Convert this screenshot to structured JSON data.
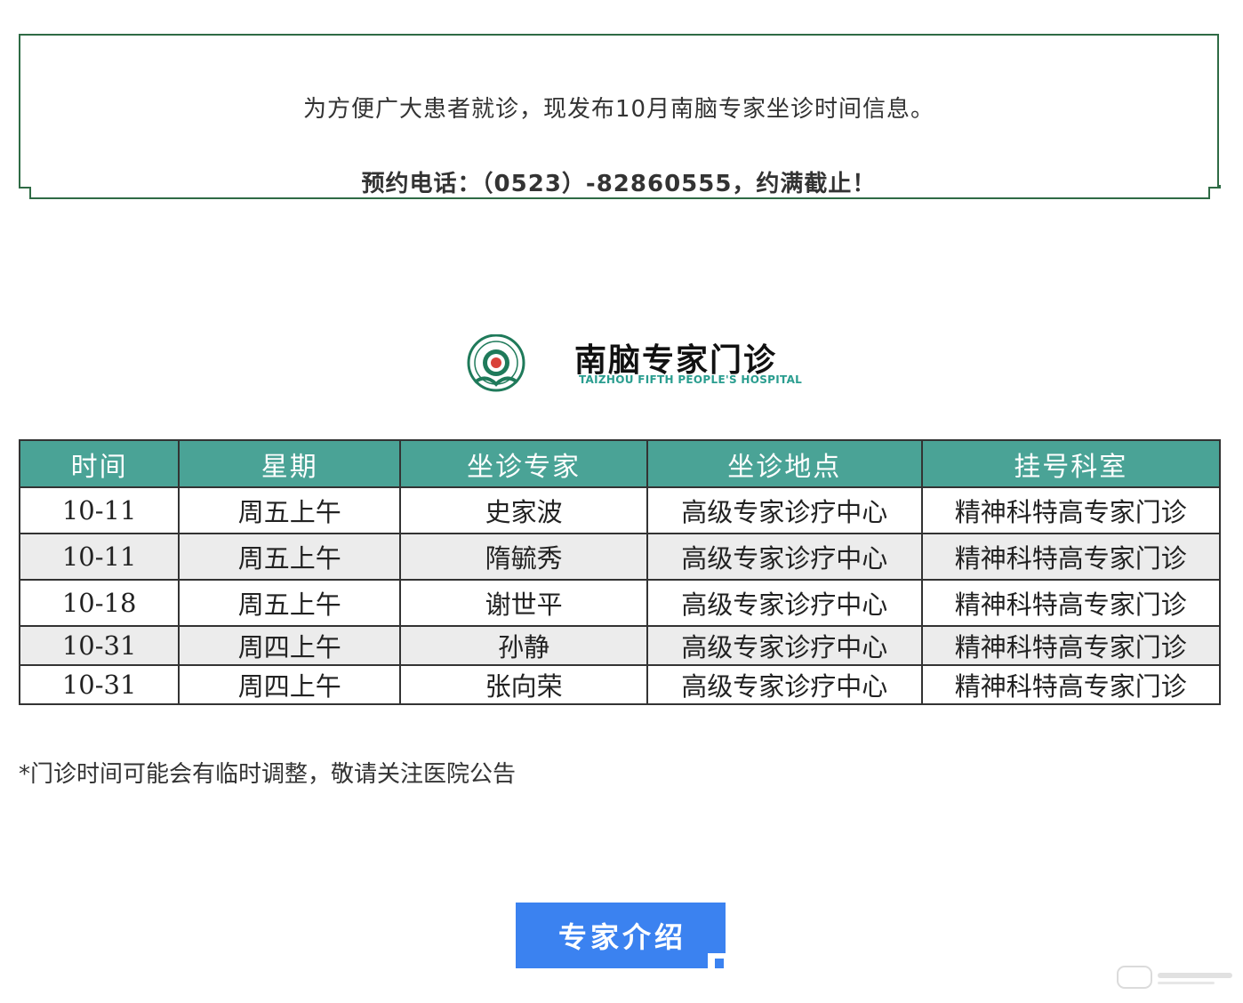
{
  "notice": {
    "line1": "为方便广大患者就诊，现发布10月南脑专家坐诊时间信息。",
    "line2": "预约电话：（0523）-82860555，约满截止！"
  },
  "header": {
    "title": "南脑专家门诊",
    "subtitle": "TAIZHOU FIFTH PEOPLE'S HOSPITAL",
    "logo_icon": "hospital-emblem-icon"
  },
  "table": {
    "columns": [
      "时间",
      "星期",
      "坐诊专家",
      "坐诊地点",
      "挂号科室"
    ],
    "rows": [
      [
        "10-11",
        "周五上午",
        "史家波",
        "高级专家诊疗中心",
        "精神科特高专家门诊"
      ],
      [
        "10-11",
        "周五上午",
        "隋毓秀",
        "高级专家诊疗中心",
        "精神科特高专家门诊"
      ],
      [
        "10-18",
        "周五上午",
        "谢世平",
        "高级专家诊疗中心",
        "精神科特高专家门诊"
      ],
      [
        "10-31",
        "周四上午",
        "孙静",
        "高级专家诊疗中心",
        "精神科特高专家门诊"
      ],
      [
        "10-31",
        "周四上午",
        "张向荣",
        "高级专家诊疗中心",
        "精神科特高专家门诊"
      ]
    ]
  },
  "footnote": "*门诊时间可能会有临时调整，敬请关注医院公告",
  "button": {
    "label": "专家介绍"
  },
  "colors": {
    "header_bg": "#4aa396",
    "border_green": "#2f6b45",
    "button_bg": "#3b82f0",
    "subtitle": "#2a9d8f"
  }
}
